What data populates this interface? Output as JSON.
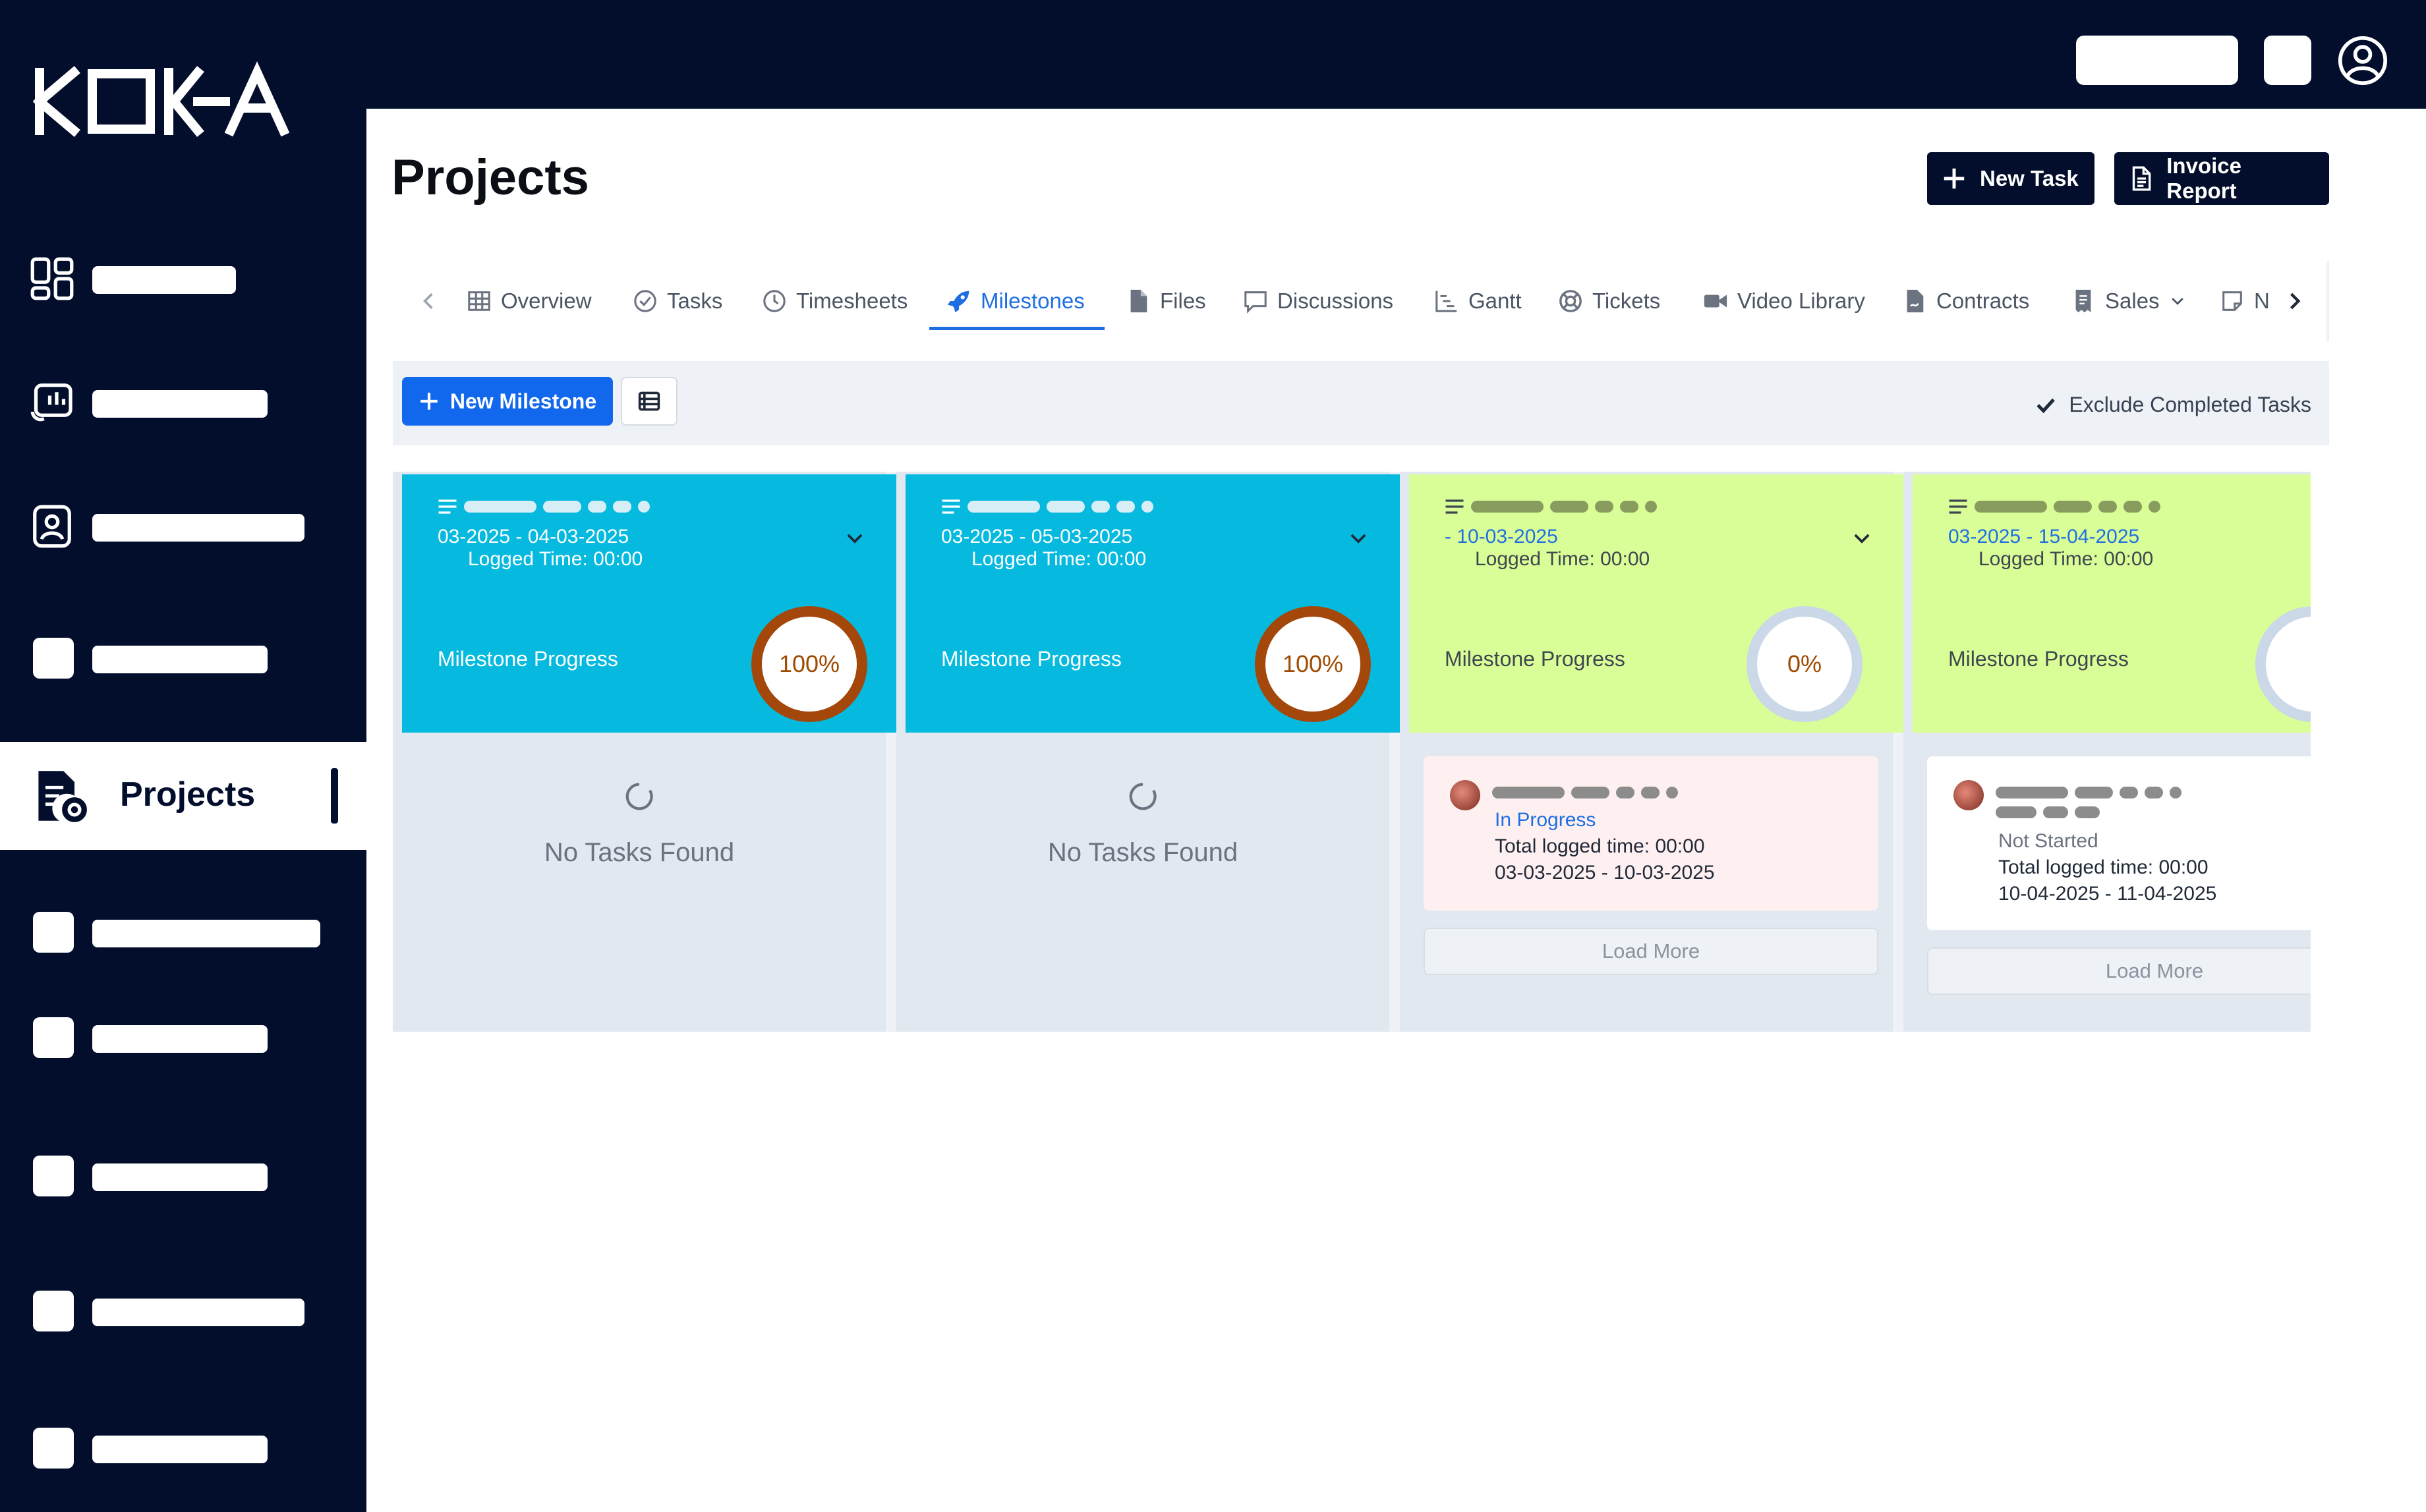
{
  "brand": {
    "logo_text": "KOHA"
  },
  "sidebar": {
    "active_item": "Projects"
  },
  "page": {
    "title": "Projects"
  },
  "actions": {
    "new_task": "New Task",
    "invoice_report": "Invoice Report"
  },
  "tabs": [
    {
      "label": "Overview",
      "icon": "table-icon"
    },
    {
      "label": "Tasks",
      "icon": "check-circle-icon"
    },
    {
      "label": "Timesheets",
      "icon": "clock-icon"
    },
    {
      "label": "Milestones",
      "icon": "rocket-icon"
    },
    {
      "label": "Files",
      "icon": "file-icon"
    },
    {
      "label": "Discussions",
      "icon": "chat-icon"
    },
    {
      "label": "Gantt",
      "icon": "gantt-icon"
    },
    {
      "label": "Tickets",
      "icon": "lifebuoy-icon"
    },
    {
      "label": "Video Library",
      "icon": "video-icon"
    },
    {
      "label": "Contracts",
      "icon": "contract-icon"
    },
    {
      "label": "Sales",
      "icon": "receipt-icon"
    },
    {
      "label": "N",
      "icon": "note-icon"
    }
  ],
  "toolbar": {
    "new_milestone": "New Milestone",
    "exclude_completed": "Exclude Completed Tasks",
    "exclude_checked": true
  },
  "colors": {
    "cyan": "#06badf",
    "lime": "#d9fe97",
    "navy": "#020e2b",
    "accent": "#1f6fe3"
  },
  "milestones": [
    {
      "dates": "03-2025 - 04-03-2025",
      "logged": "Logged Time: 00:00",
      "progress_label": "Milestone Progress",
      "progress": "100%",
      "empty_text": "No Tasks Found"
    },
    {
      "dates": "03-2025 - 05-03-2025",
      "logged": "Logged Time: 00:00",
      "progress_label": "Milestone Progress",
      "progress": "100%",
      "empty_text": "No Tasks Found"
    },
    {
      "dates": "- 10-03-2025",
      "logged": "Logged Time: 00:00",
      "progress_label": "Milestone Progress",
      "progress": "0%",
      "task": {
        "status": "In Progress",
        "logged": "Total logged time: 00:00",
        "range": "03-03-2025 - 10-03-2025"
      },
      "load_more": "Load More"
    },
    {
      "dates": "03-2025 - 15-04-2025",
      "logged": "Logged Time: 00:00",
      "progress_label": "Milestone Progress",
      "task": {
        "status": "Not Started",
        "logged": "Total logged time: 00:00",
        "range": "10-04-2025 - 11-04-2025"
      },
      "load_more": "Load More"
    }
  ]
}
